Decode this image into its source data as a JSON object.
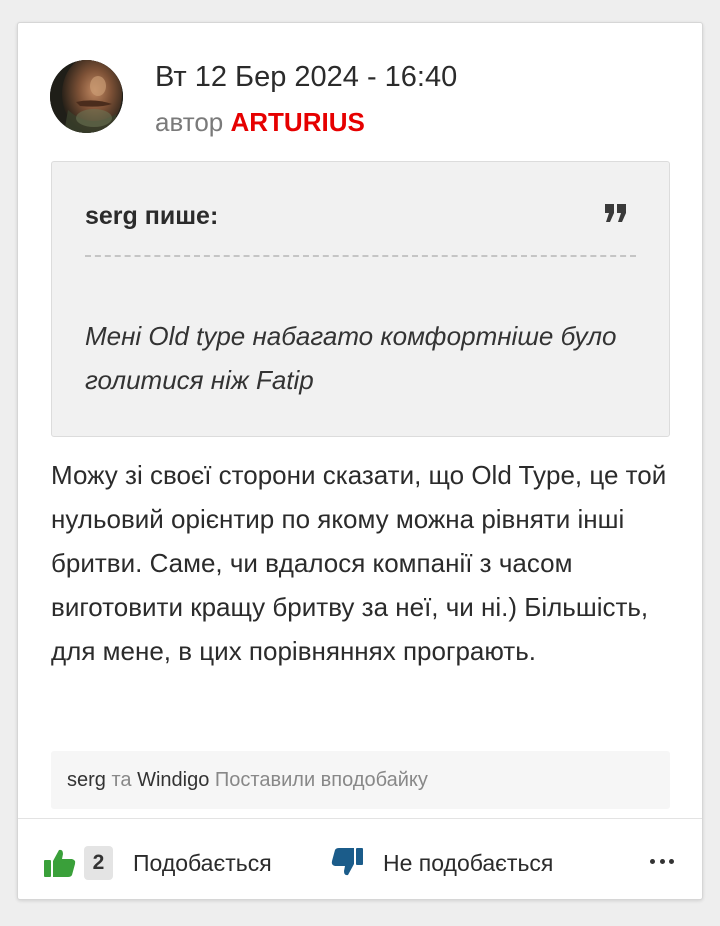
{
  "post": {
    "date": "Вт 12 Бер 2024 - 16:40",
    "author_prefix": "автор",
    "author_name": "ARTURIUS",
    "author_color": "#e60000"
  },
  "quote": {
    "header": "serg пише:",
    "icon": "quote-mark-icon",
    "text": "Мені Old type набагато комфортніше було голитися ніж Fatip"
  },
  "body": {
    "text": "Можу зі своєї сторони сказати, що Old Type, це той нульовий орієнтир по якому можна рівняти інші бритви. Саме, чи вдалося компанії з часом виготовити кращу бритву за неї, чи ні.) Більшість, для мене, в цих порівняннях програють."
  },
  "likes_info": {
    "user1": "serg",
    "separator": "та",
    "user2": "Windigo",
    "suffix": "Поставили вподобайку"
  },
  "footer": {
    "like_count": "2",
    "like_label": "Подобається",
    "like_color": "#3aa03a",
    "dislike_label": "Не подобається",
    "dislike_color": "#1b5c8a",
    "more_icon": "more-dots-icon"
  }
}
